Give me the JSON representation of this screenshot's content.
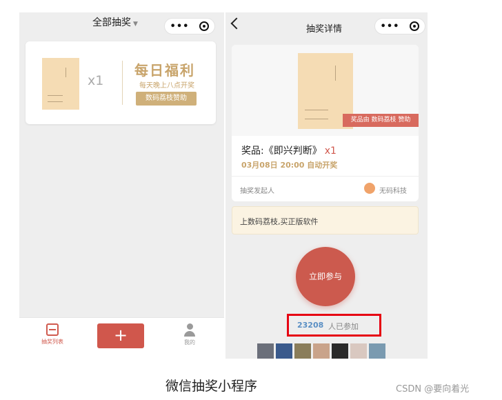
{
  "left_screen": {
    "title": "全部抽奖",
    "card": {
      "quantity": "x1",
      "headline": "每日福利",
      "subtitle": "每天晚上八点开奖",
      "sponsor_button": "数码荔枝赞助"
    },
    "tabbar": {
      "list_label": "抽奖列表",
      "add_label": "+",
      "me_label": "我的"
    }
  },
  "right_screen": {
    "title": "抽奖详情",
    "sponsor_tag": "奖品由 数码荔枝 赞助",
    "prize_label": "奖品:《即兴判断》",
    "prize_quantity": "x1",
    "draw_time": "03月08日 20:00 自动开奖",
    "sponsor_label": "抽奖发起人",
    "sponsor_name": "无码科技",
    "notice": "上数码荔枝,买正版软件",
    "join_button": "立即参与",
    "participant_count": "23208",
    "participant_suffix": "人已参加",
    "avatar_colors": [
      "#6b6f7a",
      "#3a5a8c",
      "#8a7d5a",
      "#c9a38a",
      "#2a2a2a",
      "#d9c8c0",
      "#7a9ab0"
    ]
  },
  "caption": "微信抽奖小程序",
  "watermark": "CSDN @要向着光",
  "colors": {
    "accent_red": "#d0574c",
    "gold": "#c8a46b",
    "highlight_box": "#e60012"
  }
}
